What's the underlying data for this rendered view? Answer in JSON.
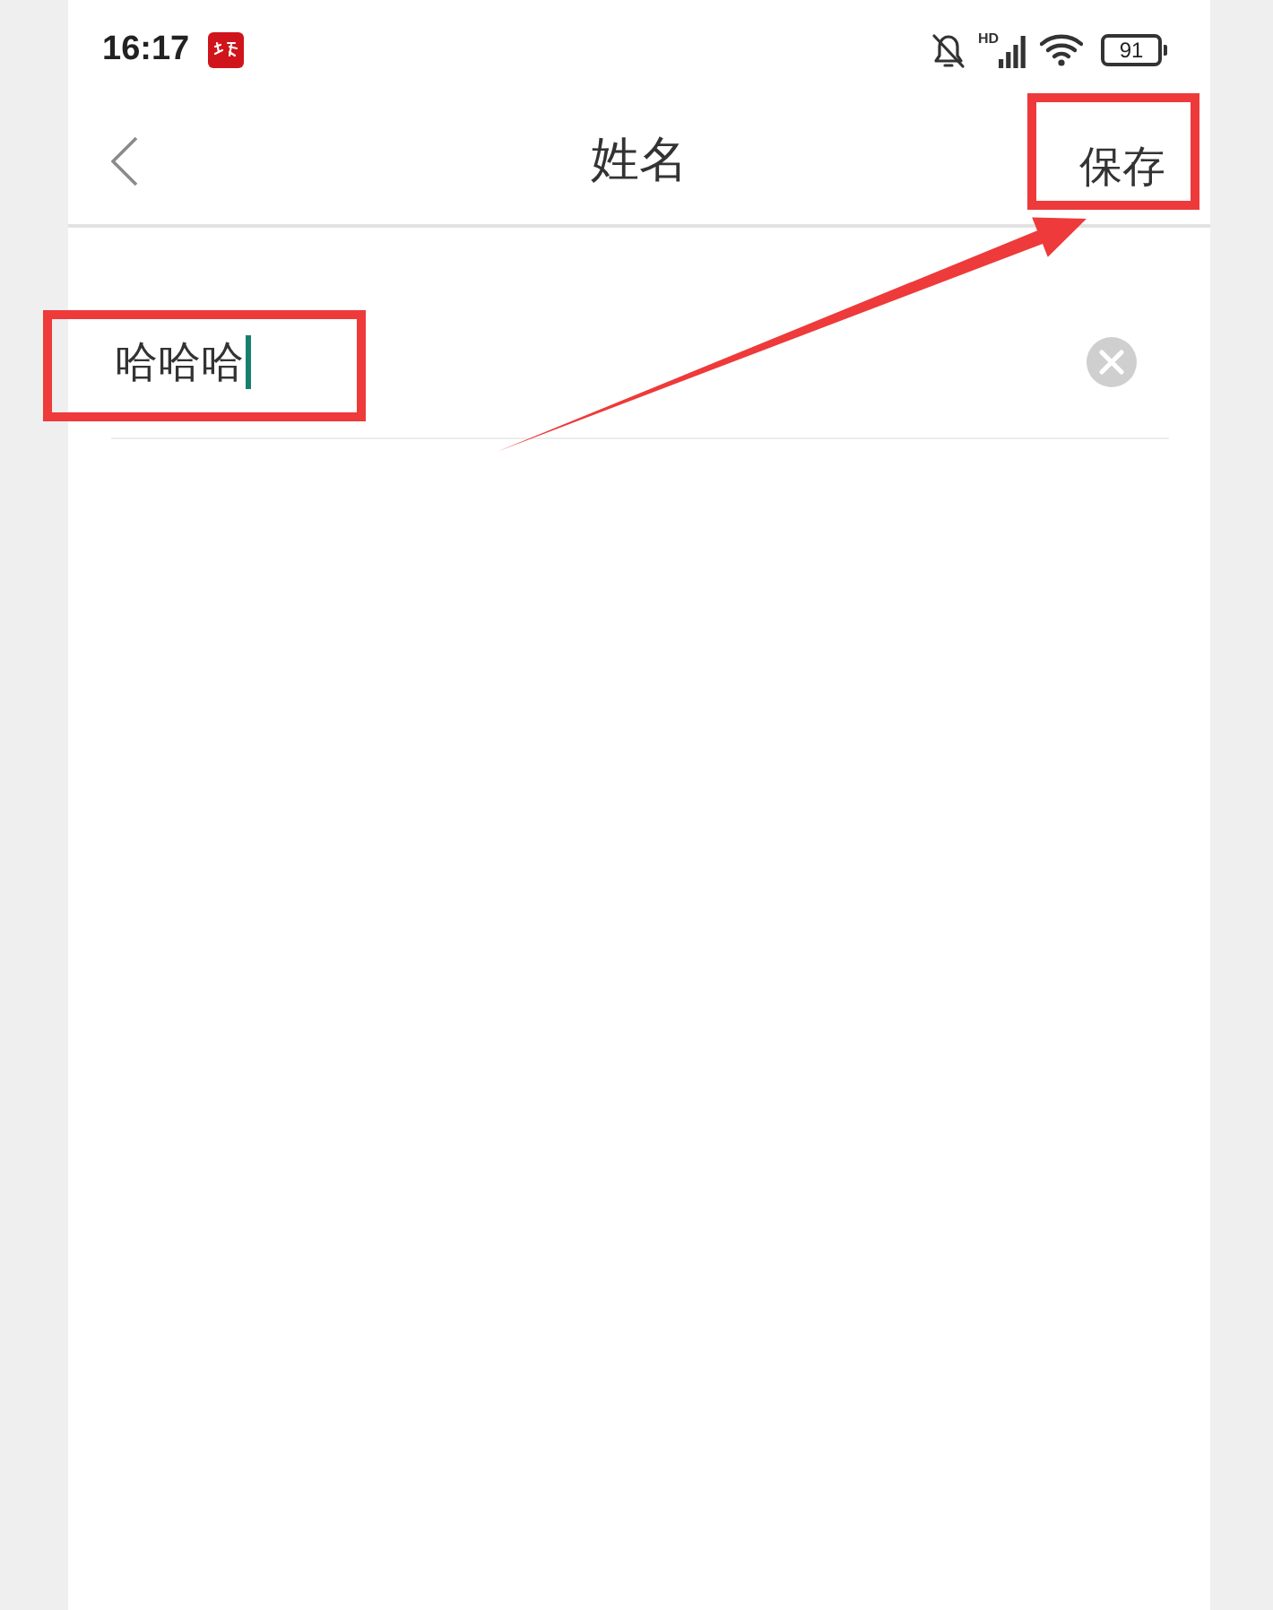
{
  "status_bar": {
    "time": "16:17",
    "notifications_muted": true,
    "network": "HD",
    "battery": "91"
  },
  "nav": {
    "title": "姓名",
    "save_button": {
      "label": "保存",
      "highlighted": true
    }
  },
  "name_field": {
    "value": "哈哈哈",
    "focused": true,
    "highlighted": true
  },
  "pointer_arrow": true
}
